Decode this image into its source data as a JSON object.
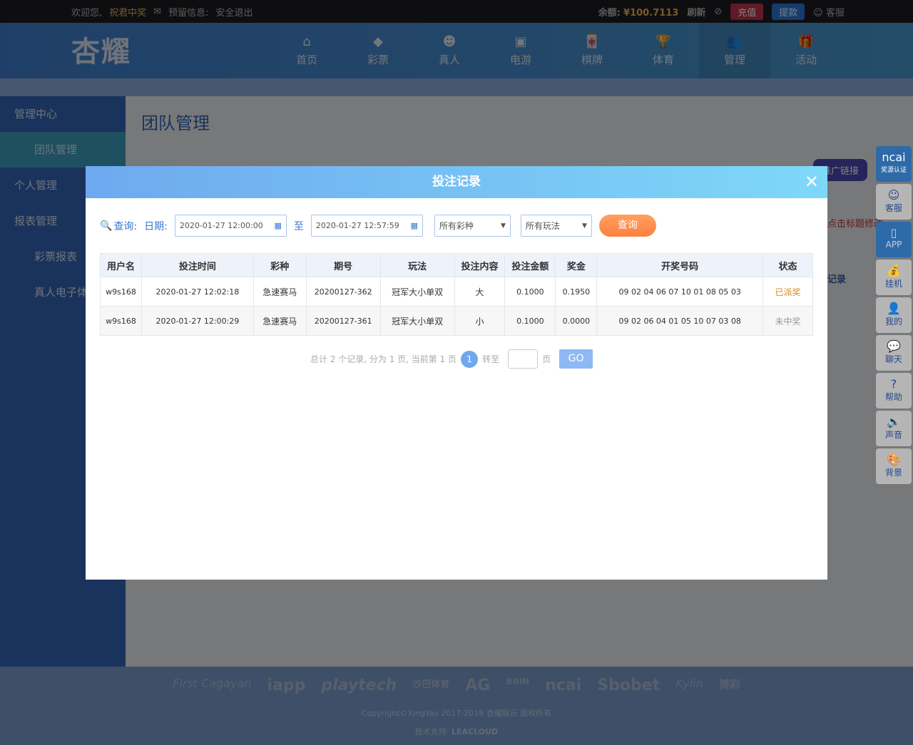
{
  "topbar": {
    "welcome": "欢迎您,",
    "username": "祝君中奖",
    "reserved": "预留信息:",
    "logout": "安全退出",
    "balance_label": "余额:",
    "balance": "¥100.7113",
    "refresh": "刷新",
    "deposit": "充值",
    "withdraw": "提款",
    "service": "客服"
  },
  "brand": {
    "logo": "杏耀"
  },
  "nav": [
    {
      "label": "首页",
      "icon": "home-icon"
    },
    {
      "label": "彩票",
      "icon": "lottery-icon"
    },
    {
      "label": "真人",
      "icon": "dealer-icon"
    },
    {
      "label": "电游",
      "icon": "slot-icon"
    },
    {
      "label": "棋牌",
      "icon": "mahjong-icon"
    },
    {
      "label": "体育",
      "icon": "trophy-icon"
    },
    {
      "label": "管理",
      "icon": "users-icon"
    },
    {
      "label": "活动",
      "icon": "gift-icon"
    }
  ],
  "sidebar": {
    "items": [
      {
        "label": "管理中心"
      },
      {
        "label": "团队管理"
      },
      {
        "label": "个人管理"
      },
      {
        "label": "报表管理"
      },
      {
        "label": "彩票报表"
      },
      {
        "label": "真人电子体"
      }
    ]
  },
  "page": {
    "title": "团队管理",
    "promo_button": "推广链接",
    "hint": "点击标题修改",
    "record_link": "记录"
  },
  "rightbar": [
    {
      "label": "奖源认证",
      "logo": "ncai"
    },
    {
      "label": "客服"
    },
    {
      "label": "APP"
    },
    {
      "label": "挂机"
    },
    {
      "label": "我的"
    },
    {
      "label": "聊天"
    },
    {
      "label": "帮助"
    },
    {
      "label": "声音"
    },
    {
      "label": "背景"
    }
  ],
  "modal": {
    "title": "投注记录",
    "query_label": "查询:",
    "date_label": "日期:",
    "start": "2020-01-27 12:00:00",
    "to": "至",
    "end": "2020-01-27 12:57:59",
    "lottery_select": "所有彩种",
    "play_select": "所有玩法",
    "query_button": "查询",
    "columns": [
      "用户名",
      "投注时间",
      "彩种",
      "期号",
      "玩法",
      "投注内容",
      "投注金额",
      "奖金",
      "开奖号码",
      "状态"
    ],
    "rows": [
      [
        "w9s168",
        "2020-01-27 12:02:18",
        "急速赛马",
        "20200127-362",
        "冠军大小单双",
        "大",
        "0.1000",
        "0.1950",
        "09 02 04 06 07 10 01 08 05 03",
        "已派奖"
      ],
      [
        "w9s168",
        "2020-01-27 12:00:29",
        "急速赛马",
        "20200127-361",
        "冠军大小单双",
        "小",
        "0.1000",
        "0.0000",
        "09 02 06 04 01 05 10 07 03 08",
        "未中奖"
      ]
    ],
    "status_colors": {
      "已派奖": "#d08a20",
      "未中奖": "#999999"
    },
    "pager": {
      "summary": "总计 2 个记录, 分为 1 页, 当前第 1 页",
      "page": "1",
      "goto": "转至",
      "page_unit": "页",
      "go": "GO"
    }
  },
  "footer": {
    "partners": [
      "First Cagayan",
      "iapp",
      "playtech",
      "沙巴体育",
      "AG",
      "BBIN",
      "ncai",
      "Sbobet",
      "Kylin",
      "博彩"
    ],
    "copyright": "Copyright©XingYao 2017-2018 杏耀娱乐 版权所有",
    "support": "技术支持:",
    "support_brand": "LEACLOUD"
  }
}
